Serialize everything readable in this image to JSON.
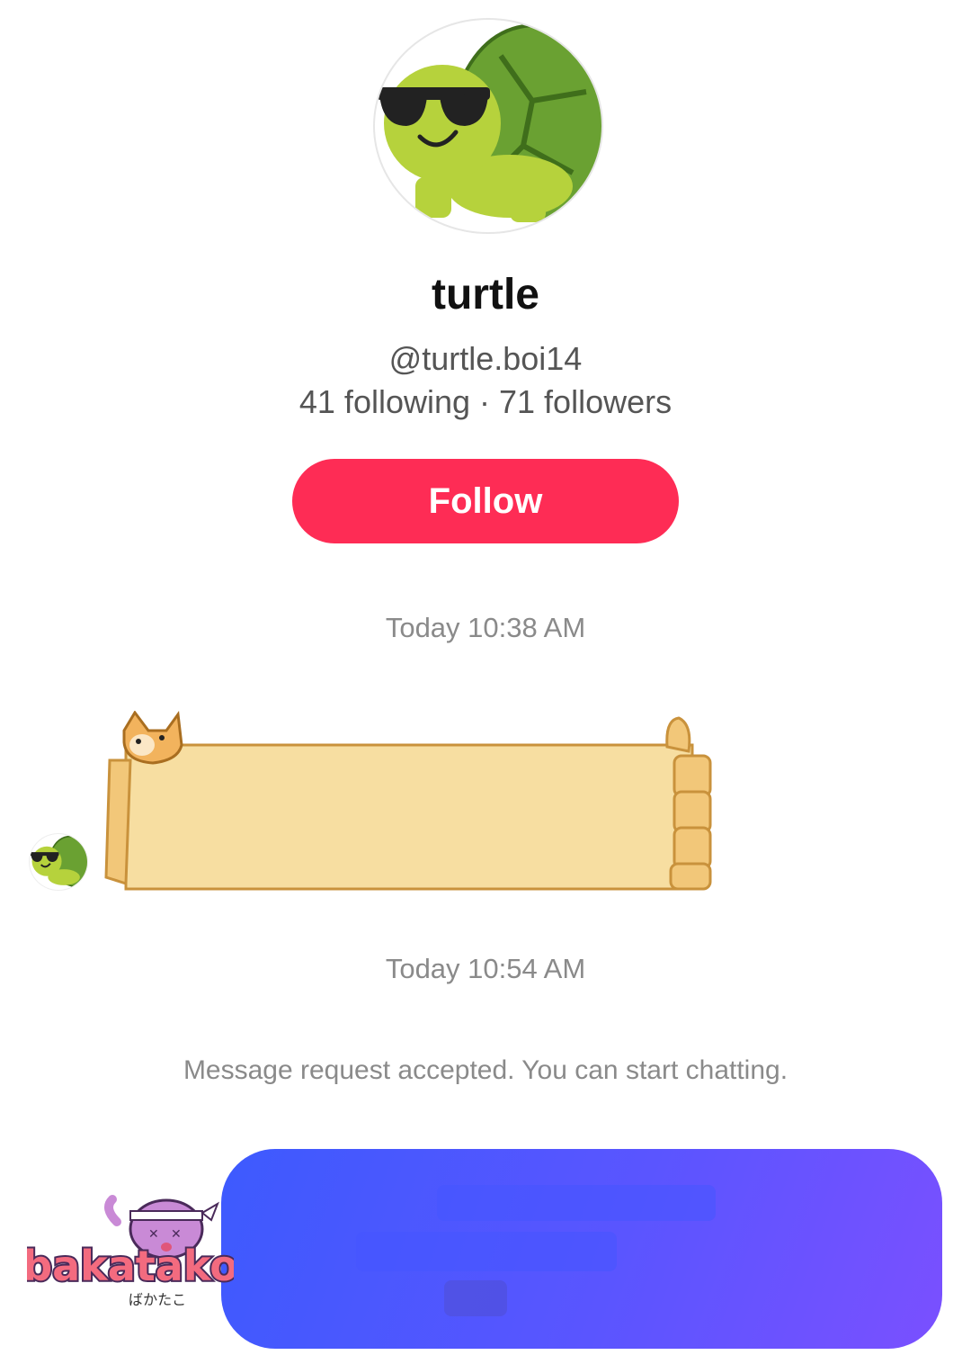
{
  "profile": {
    "display_name": "turtle",
    "handle": "@turtle.boi14",
    "stats": "41 following · 71 followers",
    "follow_label": "Follow"
  },
  "chat": {
    "timestamp_1": "Today 10:38 AM",
    "timestamp_2": "Today 10:54 AM",
    "system_message": "Message request accepted. You can start chatting."
  },
  "watermark": {
    "brand": "bakatako",
    "subtitle": "ばかたこ"
  },
  "colors": {
    "follow_button": "#fe2c55",
    "bubble_start": "#3d5afe",
    "bubble_end": "#7a50ff"
  },
  "icons": {
    "profile_avatar": "turtle-sunglasses-avatar",
    "message_sticker": "long-doge-sticker"
  }
}
